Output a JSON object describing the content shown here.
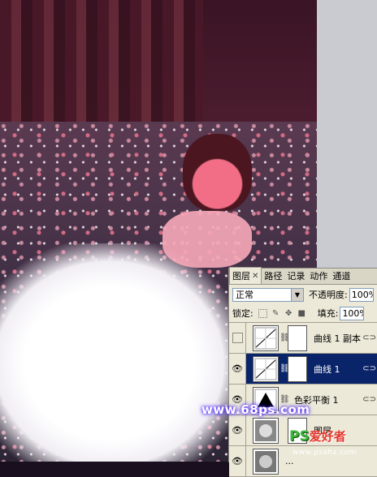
{
  "colors": {
    "panel_bg": "#ece9d8",
    "selection": "#0a246a",
    "input_border": "#7f9db9"
  },
  "watermark": {
    "url": "www.68ps.com",
    "logo_ps": "PS",
    "logo_cn": "爱好者",
    "sub": "www.psahz.com"
  },
  "layers_panel": {
    "tabs": [
      {
        "label": "图层",
        "closable": true
      },
      {
        "label": "路径"
      },
      {
        "label": "记录"
      },
      {
        "label": "动作"
      },
      {
        "label": "通道"
      }
    ],
    "blend_mode": "正常",
    "opacity_label": "不透明度:",
    "opacity_value": "100%",
    "lock_label": "锁定:",
    "fill_label": "填充:",
    "fill_value": "100%",
    "layers": [
      {
        "name": "曲线 1 副本",
        "visible": false,
        "selected": false,
        "thumb_icon": "curves-icon"
      },
      {
        "name": "曲线 1",
        "visible": true,
        "selected": true,
        "thumb_icon": "curves-icon"
      },
      {
        "name": "色彩平衡 1",
        "visible": true,
        "selected": false,
        "thumb_icon": "color-balance-icon"
      },
      {
        "name": "图层 ...",
        "visible": true,
        "selected": false,
        "thumb_icon": "layer-icon"
      },
      {
        "name": "...",
        "visible": true,
        "selected": false,
        "thumb_icon": "layer-icon"
      }
    ]
  }
}
